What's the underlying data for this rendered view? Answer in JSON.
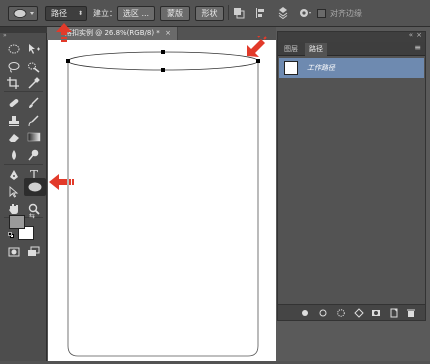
{
  "optbar": {
    "mode_value": "路径",
    "create_label": "建立：",
    "selection_btn": "选区 ...",
    "mask_btn": "蒙版",
    "shape_btn": "形状",
    "align_edges_label": "对齐边缘",
    "align_edges_checked": false
  },
  "document": {
    "tab_title": "落扣实例 @ 26.8%(RGB/8) *",
    "close": "×"
  },
  "tools": {
    "type_tool_glyph": "T"
  },
  "paths_panel": {
    "collapse": "«",
    "close": "×",
    "tabs": [
      "图层",
      "路径"
    ],
    "active_tab": "路径",
    "menu": "≡",
    "work_path_label": "工作路径"
  },
  "colors": {
    "accent_selected_row": "#6e8ab0",
    "annotation_arrow": "#e23a2a",
    "foreground_swatch": "#9a9a9a",
    "background_swatch": "#ffffff"
  }
}
